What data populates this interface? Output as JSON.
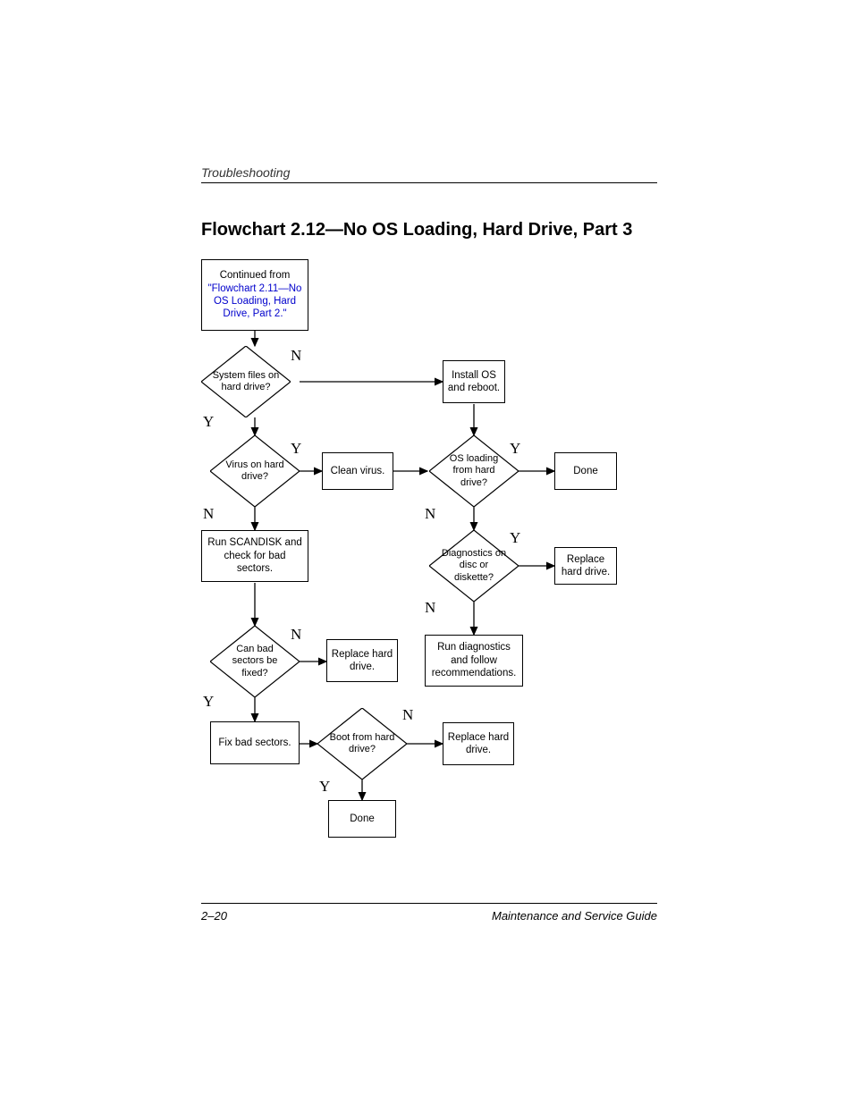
{
  "header": {
    "section": "Troubleshooting"
  },
  "title": "Flowchart 2.12—No OS Loading, Hard Drive, Part 3",
  "nodes": {
    "continued_prefix": "Continued from",
    "continued_link": "\"Flowchart 2.11—No OS Loading, Hard Drive, Part 2.\"",
    "d_system_files": "System files on hard drive?",
    "b_install_os": "Install OS and reboot.",
    "d_virus": "Virus on hard drive?",
    "b_clean_virus": "Clean virus.",
    "d_os_loading": "OS loading from hard drive?",
    "b_done1": "Done",
    "b_scandisk": "Run SCANDISK and check for bad sectors.",
    "d_diag_disc": "Diagnostics on disc or diskette?",
    "b_replace1": "Replace hard drive.",
    "d_can_fix": "Can bad sectors be fixed?",
    "b_replace2": "Replace hard drive.",
    "b_run_diag": "Run diagnostics and follow recommendations.",
    "b_fix_sectors": "Fix bad sectors.",
    "d_boot_hd": "Boot from hard drive?",
    "b_replace3": "Replace hard drive.",
    "b_done2": "Done"
  },
  "labels": {
    "Y": "Y",
    "N": "N"
  },
  "footer": {
    "page": "2–20",
    "guide": "Maintenance and Service Guide"
  }
}
